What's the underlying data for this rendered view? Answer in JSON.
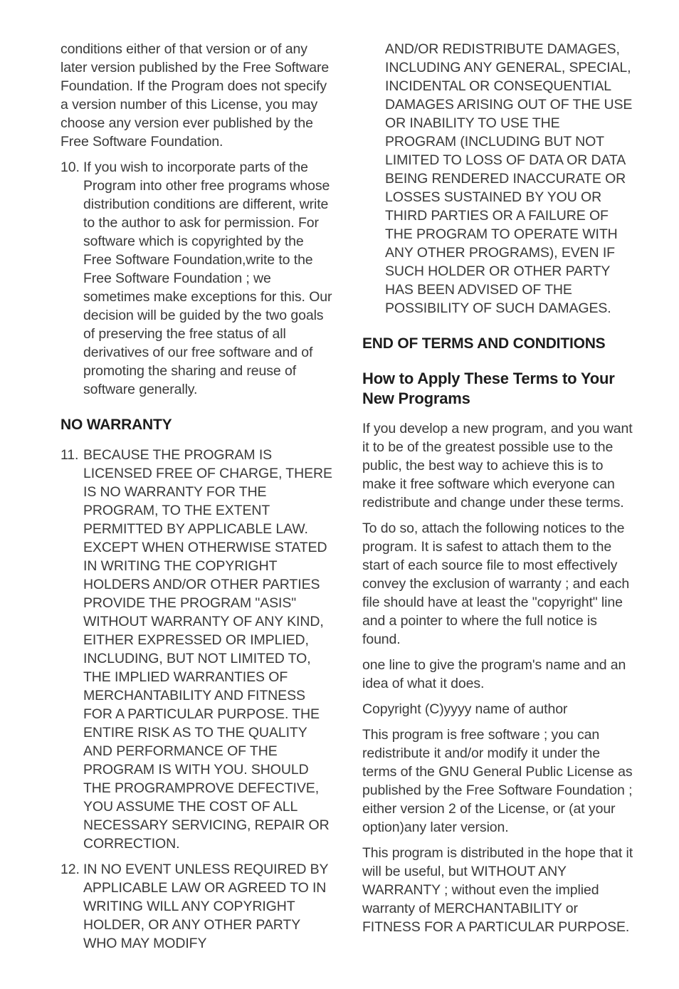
{
  "document": {
    "left_column": {
      "continued_paragraph": "conditions either of that version or of any later version published by the Free Software Foundation. If the Program does not specify a version number of this License, you may choose any version ever published by the Free Software Foundation.",
      "item_10": {
        "number": "10.",
        "text": "If you wish to incorporate parts of the Program into other free programs whose distribution conditions are different, write to the author to ask for permission. For software which is copyrighted by the Free Software Foundation,write to the Free Software Foundation ; we sometimes make exceptions for this. Our decision will be guided by the two goals of preserving the free status of all derivatives of our free software and of promoting the sharing and reuse of software generally."
      },
      "heading_no_warranty": "NO WARRANTY",
      "item_11": {
        "number": "11.",
        "text": "BECAUSE THE PROGRAM IS LICENSED FREE OF CHARGE, THERE IS NO WARRANTY FOR THE PROGRAM, TO THE EXTENT PERMITTED BY APPLICABLE LAW. EXCEPT WHEN OTHERWISE STATED IN WRITING THE COPYRIGHT HOLDERS AND/OR OTHER PARTIES PROVIDE THE PROGRAM \"ASIS\" WITHOUT WARRANTY OF ANY KIND, EITHER EXPRESSED OR IMPLIED, INCLUDING, BUT NOT LIMITED TO, THE IMPLIED WARRANTIES OF MERCHANTABILITY AND FITNESS FOR A PARTICULAR PURPOSE. THE ENTIRE RISK AS TO THE QUALITY AND PERFORMANCE OF THE PROGRAM IS WITH YOU. SHOULD THE PROGRAMPROVE DEFECTIVE, YOU ASSUME THE COST OF ALL NECESSARY SERVICING, REPAIR OR CORRECTION."
      },
      "item_12": {
        "number": "12.",
        "text": "IN NO EVENT UNLESS REQUIRED BY APPLICABLE LAW OR AGREED TO IN WRITING WILL ANY COPYRIGHT HOLDER, OR ANY OTHER PARTY WHO MAY MODIFY"
      }
    },
    "right_column": {
      "item_12_continued": "AND/OR REDISTRIBUTE DAMAGES, INCLUDING ANY GENERAL, SPECIAL, INCIDENTAL OR CONSEQUENTIAL DAMAGES ARISING OUT OF THE USE OR INABILITY TO USE THE PROGRAM (INCLUDING BUT NOT LIMITED TO LOSS OF DATA OR DATA BEING RENDERED INACCURATE OR LOSSES SUSTAINED BY YOU OR THIRD PARTIES OR A FAILURE OF THE PROGRAM TO OPERATE WITH ANY OTHER PROGRAMS), EVEN IF SUCH HOLDER OR OTHER PARTY HAS BEEN ADVISED OF THE POSSIBILITY OF SUCH DAMAGES.",
      "heading_end_of_terms": "END OF TERMS AND CONDITIONS",
      "heading_how_to_apply": "How to Apply These Terms to Your New Programs",
      "paragraph_1": "If you develop a new program, and you want it to be of the greatest possible use to the public, the best way to achieve this is to make it free software which everyone can redistribute and change under these terms.",
      "paragraph_2": "To do so, attach the following notices to the program. It is safest to attach them to the start of each source file to most effectively convey the exclusion of warranty ; and each file should have at least the \"copyright\" line and a pointer to where the full notice is found.",
      "paragraph_3": "one line to give the program's name and an idea of what it does.",
      "paragraph_4": "Copyright (C)yyyy name of author",
      "paragraph_5": "This program is free software ; you can redistribute it and/or modify it under the terms of the GNU General Public License as published by the Free Software Foundation ; either version 2 of the License, or (at your option)any later version.",
      "paragraph_6": "This program is distributed in the hope that it will be useful, but WITHOUT ANY WARRANTY ; without even the implied warranty of MERCHANTABILITY or FITNESS FOR A PARTICULAR PURPOSE."
    }
  }
}
